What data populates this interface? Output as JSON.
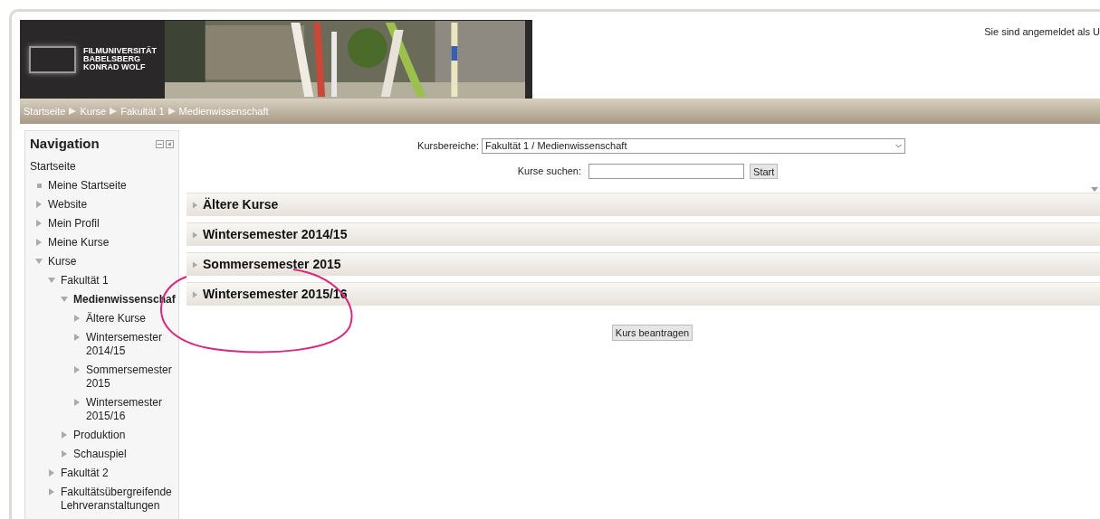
{
  "header": {
    "logo_lines": [
      "FILMUNIVERSITÄT",
      "BABELSBERG",
      "KONRAD WOLF"
    ],
    "picture": {
      "kind": "picture"
    },
    "login_info": "Sie sind angemeldet als U"
  },
  "breadcrumb": [
    "Startseite",
    "Kurse",
    "Fakultät 1",
    "Medienwissenschaft"
  ],
  "navigation": {
    "title": "Navigation",
    "items": [
      {
        "label": "Startseite",
        "kind": "root",
        "selected": false
      },
      {
        "label": "Meine Startseite",
        "kind": "leaf",
        "selected": false
      },
      {
        "label": "Website",
        "kind": "branch",
        "expanded": false,
        "selected": false
      },
      {
        "label": "Mein Profil",
        "kind": "branch",
        "expanded": false,
        "selected": false
      },
      {
        "label": "Meine Kurse",
        "kind": "branch",
        "expanded": false,
        "selected": false
      },
      {
        "label": "Kurse",
        "kind": "branch",
        "expanded": true,
        "selected": false,
        "children": [
          {
            "label": "Fakultät 1",
            "kind": "branch",
            "expanded": true,
            "selected": false,
            "children": [
              {
                "label": "Medienwissenschaf",
                "kind": "branch",
                "expanded": true,
                "selected": true,
                "children": [
                  {
                    "label": "Ältere Kurse",
                    "kind": "branch",
                    "expanded": false,
                    "selected": false
                  },
                  {
                    "label": "Wintersemester 2014/15",
                    "kind": "branch",
                    "expanded": false,
                    "selected": false
                  },
                  {
                    "label": "Sommersemester 2015",
                    "kind": "branch",
                    "expanded": false,
                    "selected": false
                  },
                  {
                    "label": "Wintersemester 2015/16",
                    "kind": "branch",
                    "expanded": false,
                    "selected": false
                  }
                ]
              },
              {
                "label": "Produktion",
                "kind": "branch",
                "expanded": false,
                "selected": false
              },
              {
                "label": "Schauspiel",
                "kind": "branch",
                "expanded": false,
                "selected": false
              }
            ]
          },
          {
            "label": "Fakultät 2",
            "kind": "branch",
            "expanded": false,
            "selected": false
          },
          {
            "label": "Fakultätsübergreifende Lehrveranstaltungen",
            "kind": "branch",
            "expanded": false,
            "selected": false
          }
        ]
      }
    ]
  },
  "category_select": {
    "label": "Kursbereiche:",
    "value": "Fakultät 1 / Medienwissenschaft"
  },
  "search": {
    "label": "Kurse suchen:",
    "button": "Start"
  },
  "categories": [
    {
      "title": "Ältere Kurse",
      "expanded": false
    },
    {
      "title": "Wintersemester 2014/15",
      "expanded": false
    },
    {
      "title": "Sommersemester 2015",
      "expanded": false
    },
    {
      "title": "Wintersemester 2015/16",
      "expanded": false
    }
  ],
  "request_button": "Kurs beantragen"
}
